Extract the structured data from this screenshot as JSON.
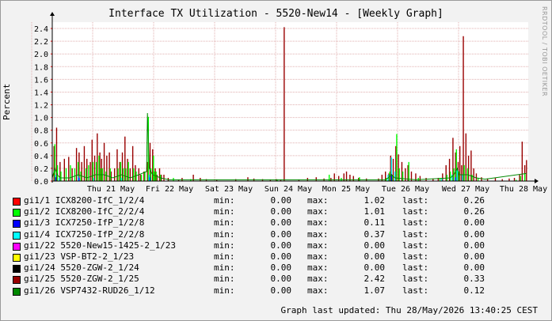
{
  "header": {
    "title": "Interface TX Utilization - 5520-New14 - [Weekly Graph]",
    "watermark": "RRDTOOL / TOBI OETIKER"
  },
  "chart_data": {
    "type": "bar",
    "ylabel": "Percent",
    "ylim": [
      0,
      2.5
    ],
    "yticks": [
      0.0,
      0.2,
      0.4,
      0.6,
      0.8,
      1.0,
      1.2,
      1.4,
      1.6,
      1.8,
      2.0,
      2.2,
      2.4
    ],
    "ytick_labels": [
      "0.0",
      "0.2",
      "0.4",
      "0.6",
      "0.8",
      "1.0",
      "1.2",
      "1.4",
      "1.6",
      "1.8",
      "2.0",
      "2.2",
      "2.4"
    ],
    "xtick_labels": [
      "Thu 21 May",
      "Fri 22 May",
      "Sat 23 May",
      "Sun 24 May",
      "Mon 25 May",
      "Tue 26 May",
      "Wed 27 May",
      "Thu 28 May"
    ],
    "grid": true,
    "legend_position": "bottom",
    "series": [
      {
        "name": "gi1/25 5520-ZGW-2_1/25",
        "color": "#990000",
        "kind": "bar",
        "points": [
          [
            2,
            0.55
          ],
          [
            5,
            0.84
          ],
          [
            9,
            0.3
          ],
          [
            14,
            0.35
          ],
          [
            19,
            0.38
          ],
          [
            23,
            0.2
          ],
          [
            28,
            0.52
          ],
          [
            31,
            0.45
          ],
          [
            34,
            0.3
          ],
          [
            37,
            0.55
          ],
          [
            40,
            0.35
          ],
          [
            44,
            0.3
          ],
          [
            46,
            0.65
          ],
          [
            49,
            0.4
          ],
          [
            52,
            0.75
          ],
          [
            55,
            0.45
          ],
          [
            57,
            0.35
          ],
          [
            60,
            0.6
          ],
          [
            63,
            0.4
          ],
          [
            66,
            0.45
          ],
          [
            68,
            0.15
          ],
          [
            72,
            0.2
          ],
          [
            75,
            0.5
          ],
          [
            78,
            0.3
          ],
          [
            81,
            0.45
          ],
          [
            84,
            0.7
          ],
          [
            87,
            0.35
          ],
          [
            90,
            0.2
          ],
          [
            93,
            0.55
          ],
          [
            96,
            0.25
          ],
          [
            100,
            0.2
          ],
          [
            102,
            0.1
          ],
          [
            106,
            0.15
          ],
          [
            110,
            0.3
          ],
          [
            113,
            0.6
          ],
          [
            116,
            0.5
          ],
          [
            119,
            0.2
          ],
          [
            121,
            0.1
          ],
          [
            124,
            0.2
          ],
          [
            126,
            0.1
          ],
          [
            129,
            0.1
          ],
          [
            134,
            0.05
          ],
          [
            146,
            0.02
          ],
          [
            150,
            0.05
          ],
          [
            163,
            0.1
          ],
          [
            171,
            0.05
          ],
          [
            178,
            0.03
          ],
          [
            190,
            0.02
          ],
          [
            212,
            0.03
          ],
          [
            226,
            0.06
          ],
          [
            233,
            0.04
          ],
          [
            243,
            0.03
          ],
          [
            252,
            0.02
          ],
          [
            259,
            0.03
          ],
          [
            264,
            0.02
          ],
          [
            268,
            2.42
          ],
          [
            285,
            0.02
          ],
          [
            295,
            0.05
          ],
          [
            305,
            0.06
          ],
          [
            314,
            0.04
          ],
          [
            322,
            0.05
          ],
          [
            326,
            0.12
          ],
          [
            331,
            0.08
          ],
          [
            337,
            0.12
          ],
          [
            340,
            0.15
          ],
          [
            344,
            0.1
          ],
          [
            348,
            0.08
          ],
          [
            354,
            0.05
          ],
          [
            363,
            0.04
          ],
          [
            377,
            0.04
          ],
          [
            381,
            0.1
          ],
          [
            385,
            0.15
          ],
          [
            389,
            0.12
          ],
          [
            391,
            0.4
          ],
          [
            394,
            0.35
          ],
          [
            397,
            0.55
          ],
          [
            400,
            0.42
          ],
          [
            404,
            0.3
          ],
          [
            408,
            0.2
          ],
          [
            411,
            0.25
          ],
          [
            415,
            0.15
          ],
          [
            420,
            0.12
          ],
          [
            425,
            0.08
          ],
          [
            432,
            0.05
          ],
          [
            440,
            0.04
          ],
          [
            446,
            0.05
          ],
          [
            451,
            0.12
          ],
          [
            455,
            0.25
          ],
          [
            459,
            0.35
          ],
          [
            463,
            0.68
          ],
          [
            466,
            0.45
          ],
          [
            469,
            0.3
          ],
          [
            471,
            0.55
          ],
          [
            473,
            0.25
          ],
          [
            475,
            2.28
          ],
          [
            478,
            0.75
          ],
          [
            481,
            0.4
          ],
          [
            484,
            0.48
          ],
          [
            487,
            0.2
          ],
          [
            490,
            0.12
          ],
          [
            496,
            0.06
          ],
          [
            503,
            0.04
          ],
          [
            512,
            0.05
          ],
          [
            520,
            0.03
          ],
          [
            528,
            0.04
          ],
          [
            534,
            0.05
          ],
          [
            540,
            0.1
          ],
          [
            543,
            0.62
          ],
          [
            546,
            0.25
          ],
          [
            548,
            0.33
          ]
        ]
      },
      {
        "name": "gi1/2 ICX8200-IfC_2/2/4",
        "color": "#00ff00",
        "kind": "bar",
        "points": [
          [
            3,
            0.58
          ],
          [
            6,
            0.25
          ],
          [
            10,
            0.15
          ],
          [
            16,
            0.2
          ],
          [
            21,
            0.25
          ],
          [
            26,
            0.2
          ],
          [
            30,
            0.3
          ],
          [
            33,
            0.15
          ],
          [
            39,
            0.2
          ],
          [
            42,
            0.25
          ],
          [
            47,
            0.3
          ],
          [
            51,
            0.3
          ],
          [
            54,
            0.4
          ],
          [
            56,
            0.2
          ],
          [
            58,
            0.2
          ],
          [
            62,
            0.15
          ],
          [
            67,
            0.2
          ],
          [
            76,
            0.2
          ],
          [
            79,
            0.3
          ],
          [
            82,
            0.2
          ],
          [
            85,
            0.2
          ],
          [
            88,
            0.3
          ],
          [
            94,
            0.2
          ],
          [
            97,
            0.15
          ],
          [
            103,
            0.1
          ],
          [
            107,
            0.15
          ],
          [
            111,
            1.01
          ],
          [
            114,
            0.2
          ],
          [
            117,
            0.4
          ],
          [
            118,
            0.15
          ],
          [
            120,
            0.15
          ],
          [
            125,
            0.1
          ],
          [
            140,
            0.05
          ],
          [
            160,
            0.03
          ],
          [
            260,
            0.02
          ],
          [
            320,
            0.1
          ],
          [
            334,
            0.05
          ],
          [
            355,
            0.06
          ],
          [
            386,
            0.05
          ],
          [
            390,
            0.15
          ],
          [
            393,
            0.1
          ],
          [
            398,
            0.74
          ],
          [
            401,
            0.2
          ],
          [
            405,
            0.15
          ],
          [
            412,
            0.3
          ],
          [
            423,
            0.05
          ],
          [
            448,
            0.05
          ],
          [
            456,
            0.1
          ],
          [
            460,
            0.15
          ],
          [
            464,
            0.2
          ],
          [
            467,
            0.5
          ],
          [
            470,
            0.15
          ],
          [
            476,
            0.25
          ],
          [
            480,
            0.2
          ],
          [
            485,
            0.1
          ],
          [
            492,
            0.05
          ],
          [
            536,
            0.02
          ],
          [
            541,
            0.08
          ],
          [
            546,
            0.12
          ]
        ]
      },
      {
        "name": "gi1/4 ICX7250-IfP_2/2/8",
        "color": "#00ffff",
        "kind": "bar",
        "points": [
          [
            4,
            0.1
          ],
          [
            8,
            0.05
          ],
          [
            30,
            0.08
          ],
          [
            48,
            0.05
          ],
          [
            80,
            0.05
          ],
          [
            112,
            0.1
          ],
          [
            388,
            0.1
          ],
          [
            392,
            0.37
          ],
          [
            396,
            0.15
          ],
          [
            450,
            0.05
          ],
          [
            462,
            0.1
          ],
          [
            468,
            0.2
          ],
          [
            474,
            0.1
          ]
        ]
      },
      {
        "name": "gi1/3 ICX7250-IfP_1/2/8",
        "color": "#0000ff",
        "kind": "bar",
        "points": [
          [
            4,
            0.06
          ],
          [
            31,
            0.05
          ],
          [
            113,
            0.06
          ],
          [
            392,
            0.11
          ],
          [
            466,
            0.06
          ]
        ]
      },
      {
        "name": "gi1/26 VSP7432-RUD26_1/12",
        "color": "#008800",
        "kind": "line",
        "points": [
          [
            0,
            0.05
          ],
          [
            3,
            0.2
          ],
          [
            6,
            0.1
          ],
          [
            9,
            0.05
          ],
          [
            20,
            0.05
          ],
          [
            30,
            0.1
          ],
          [
            40,
            0.05
          ],
          [
            50,
            0.1
          ],
          [
            60,
            0.1
          ],
          [
            70,
            0.05
          ],
          [
            80,
            0.1
          ],
          [
            90,
            0.05
          ],
          [
            100,
            0.1
          ],
          [
            109,
            0.15
          ],
          [
            110,
            1.07
          ],
          [
            112,
            0.2
          ],
          [
            116,
            0.1
          ],
          [
            125,
            0.05
          ],
          [
            135,
            0.02
          ],
          [
            150,
            0.02
          ],
          [
            200,
            0.02
          ],
          [
            260,
            0.02
          ],
          [
            300,
            0.02
          ],
          [
            340,
            0.02
          ],
          [
            385,
            0.02
          ],
          [
            388,
            0.05
          ],
          [
            392,
            0.1
          ],
          [
            396,
            0.05
          ],
          [
            420,
            0.02
          ],
          [
            460,
            0.05
          ],
          [
            464,
            0.1
          ],
          [
            468,
            0.2
          ],
          [
            470,
            0.1
          ],
          [
            480,
            0.1
          ],
          [
            490,
            0.05
          ],
          [
            500,
            0.03
          ],
          [
            548,
            0.12
          ]
        ]
      }
    ],
    "legend": [
      {
        "name": "gi1/1 ICX8200-IfC_1/2/4",
        "color": "#ff0000",
        "min": "0.00",
        "max": "1.02",
        "last": "0.26"
      },
      {
        "name": "gi1/2 ICX8200-IfC_2/2/4",
        "color": "#00ff00",
        "min": "0.00",
        "max": "1.01",
        "last": "0.26"
      },
      {
        "name": "gi1/3 ICX7250-IfP_1/2/8",
        "color": "#0000ff",
        "min": "0.00",
        "max": "0.11",
        "last": "0.00"
      },
      {
        "name": "gi1/4 ICX7250-IfP_2/2/8",
        "color": "#00ffff",
        "min": "0.00",
        "max": "0.37",
        "last": "0.00"
      },
      {
        "name": "gi1/22 5520-New15-1425-2_1/23",
        "color": "#ff00ff",
        "min": "0.00",
        "max": "0.00",
        "last": "0.00"
      },
      {
        "name": "gi1/23 VSP-BT2-2_1/23",
        "color": "#ffff00",
        "min": "0.00",
        "max": "0.00",
        "last": "0.00"
      },
      {
        "name": "gi1/24 5520-ZGW-2_1/24",
        "color": "#000000",
        "min": "0.00",
        "max": "0.00",
        "last": "0.00"
      },
      {
        "name": "gi1/25 5520-ZGW-2_1/25",
        "color": "#990000",
        "min": "0.00",
        "max": "2.42",
        "last": "0.33"
      },
      {
        "name": "gi1/26 VSP7432-RUD26_1/12",
        "color": "#008800",
        "min": "0.00",
        "max": "1.07",
        "last": "0.12"
      }
    ],
    "stat_labels": {
      "min": "min:",
      "max": "max:",
      "last": "last:"
    }
  },
  "footer": {
    "updated": "Graph last updated: Thu 28/May/2026 13:40:25 CEST"
  }
}
